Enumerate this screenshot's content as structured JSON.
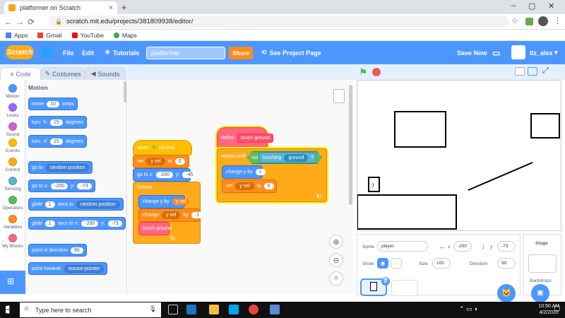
{
  "browser": {
    "tab_title": "platformer on Scratch",
    "tab_close": "×",
    "new_tab": "+",
    "url": "scratch.mit.edu/projects/381809938/editor/",
    "bookmarks": [
      "Apps",
      "Gmail",
      "YouTube",
      "Maps"
    ],
    "window_controls": [
      "–",
      "▢",
      "✕"
    ]
  },
  "menu": {
    "logo": "Scratch",
    "file": "File",
    "edit": "Edit",
    "tutorials": "Tutorials",
    "project_name": "platformer",
    "share": "Share",
    "see_project": "See Project Page",
    "save_now": "Save Now",
    "username": "tlz_alex"
  },
  "tabs": {
    "code": "Code",
    "costumes": "Costumes",
    "sounds": "Sounds"
  },
  "categories": [
    {
      "label": "Motion",
      "color": "#4c97ff"
    },
    {
      "label": "Looks",
      "color": "#9966ff"
    },
    {
      "label": "Sound",
      "color": "#cf63cf"
    },
    {
      "label": "Events",
      "color": "#ffbf00"
    },
    {
      "label": "Control",
      "color": "#ffab19"
    },
    {
      "label": "Sensing",
      "color": "#5cb1d6"
    },
    {
      "label": "Operators",
      "color": "#59c059"
    },
    {
      "label": "Variables",
      "color": "#ff8c1a"
    },
    {
      "label": "My Blocks",
      "color": "#ff6680"
    }
  ],
  "palette": {
    "heading": "Motion",
    "move": {
      "label": "move",
      "value": "10",
      "suffix": "steps"
    },
    "turn_right": {
      "label": "turn",
      "value": "15",
      "suffix": "degrees"
    },
    "turn_left": {
      "label": "turn",
      "value": "15",
      "suffix": "degrees"
    },
    "go_to": {
      "label": "go to",
      "option": "random position"
    },
    "go_to_xy": {
      "label": "go to x:",
      "x": "-200",
      "ylabel": "y:",
      "y": "-73"
    },
    "glide_to": {
      "label": "glide",
      "secs": "1",
      "mid": "secs to",
      "option": "random position"
    },
    "glide_xy": {
      "label": "glide",
      "secs": "1",
      "mid": "secs to x:",
      "x": "-200",
      "ylabel": "y:",
      "y": "-73"
    },
    "point_dir": {
      "label": "point in direction",
      "value": "90"
    },
    "point_towards": {
      "label": "point towards",
      "option": "mouse-pointer"
    }
  },
  "script1": {
    "hat": "when",
    "hat_suffix": "clicked",
    "set_label": "set",
    "set_var": "y vel",
    "set_to": "to",
    "set_value": "0",
    "goto_label": "go to x:",
    "goto_x": "-200",
    "goto_ylabel": "y:",
    "goto_y": "-45",
    "forever": "forever",
    "change_y_label": "change y by",
    "change_y_value": "y vel",
    "change_var_label": "change",
    "change_var": "y vel",
    "change_by": "by",
    "change_value": "-1",
    "custom": "touch ground"
  },
  "script2": {
    "define": "define",
    "define_name": "touch ground",
    "repeat_until": "repeat until",
    "not": "not",
    "touching": "touching",
    "touching_target": "ground",
    "q": "?",
    "change_y_label": "change y by",
    "change_y_value": "1",
    "set_label": "set",
    "set_var": "y vel",
    "set_to": "to",
    "set_value": "0"
  },
  "sprite_info": {
    "sprite_label": "Sprite",
    "sprite_name": "player",
    "x": "-200",
    "x_label": "x",
    "y_label": "y",
    "y": "-73",
    "show_label": "Show",
    "size_label": "Size",
    "size": "100",
    "direction_label": "Direction",
    "direction": "90"
  },
  "stage_panel": {
    "title": "Stage",
    "backdrops_label": "Backdrops"
  },
  "taskbar": {
    "search_placeholder": "Type here to search",
    "time": "10:50 AM",
    "date": "4/2/2020"
  }
}
